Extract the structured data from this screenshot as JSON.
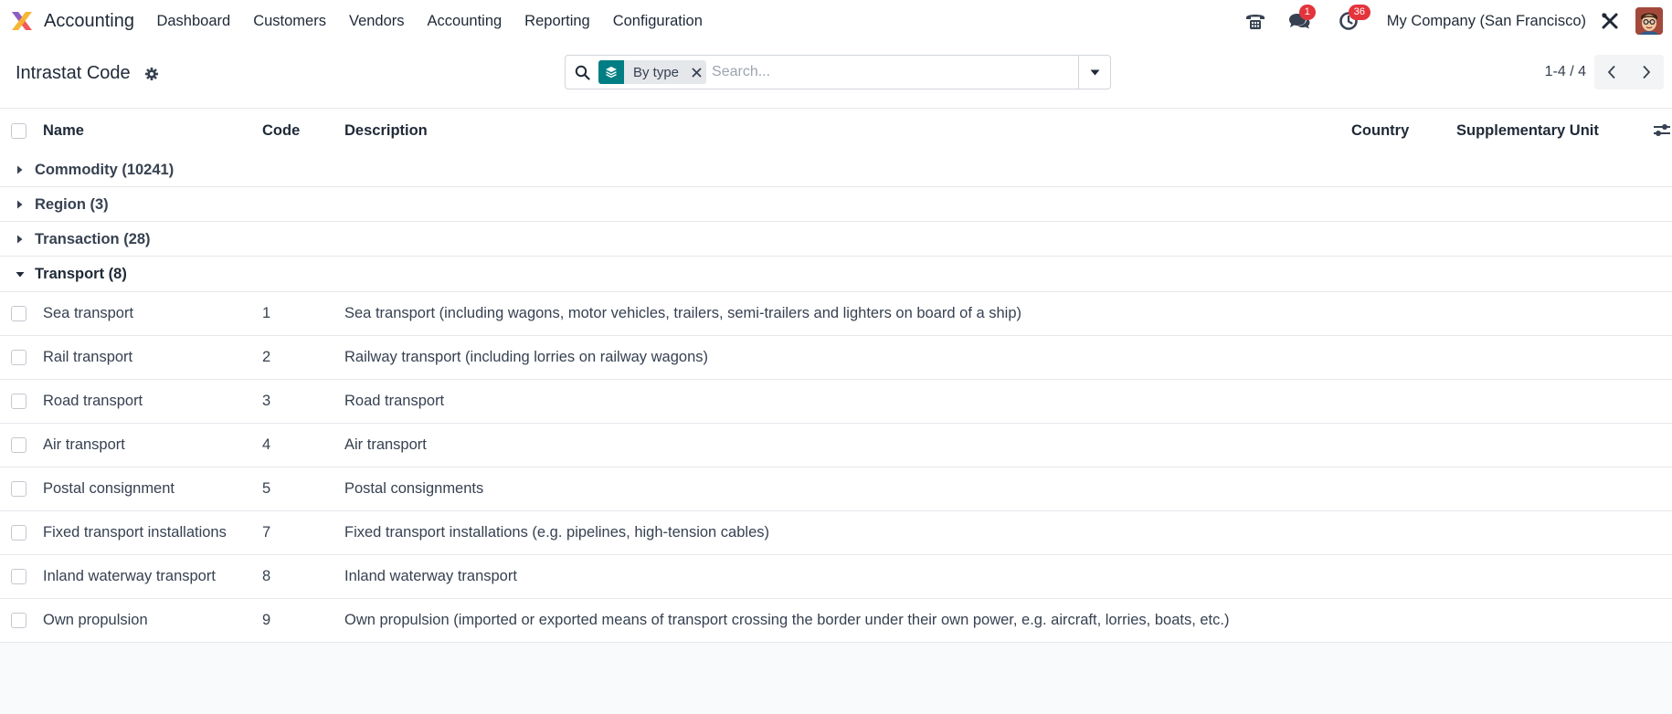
{
  "navbar": {
    "app_name": "Accounting",
    "menu": [
      "Dashboard",
      "Customers",
      "Vendors",
      "Accounting",
      "Reporting",
      "Configuration"
    ],
    "messages_badge": "1",
    "activities_badge": "36",
    "company": "My Company (San Francisco)"
  },
  "control_panel": {
    "title": "Intrastat Code",
    "facet_label": "By type",
    "search_placeholder": "Search...",
    "pager": "1-4 / 4"
  },
  "list": {
    "columns": {
      "name": "Name",
      "code": "Code",
      "description": "Description",
      "country": "Country",
      "unit": "Supplementary Unit"
    },
    "groups": [
      {
        "label": "Commodity (10241)",
        "expanded": false
      },
      {
        "label": "Region (3)",
        "expanded": false
      },
      {
        "label": "Transaction (28)",
        "expanded": false
      },
      {
        "label": "Transport (8)",
        "expanded": true
      }
    ],
    "rows": [
      {
        "name": "Sea transport",
        "code": "1",
        "description": "Sea transport (including wagons, motor vehicles, trailers, semi-trailers and lighters on board of a ship)"
      },
      {
        "name": "Rail transport",
        "code": "2",
        "description": "Railway transport (including lorries on railway wagons)"
      },
      {
        "name": "Road transport",
        "code": "3",
        "description": "Road transport"
      },
      {
        "name": "Air transport",
        "code": "4",
        "description": "Air transport"
      },
      {
        "name": "Postal consignment",
        "code": "5",
        "description": "Postal consignments"
      },
      {
        "name": "Fixed transport installations",
        "code": "7",
        "description": "Fixed transport installations (e.g. pipelines, high-tension cables)"
      },
      {
        "name": "Inland waterway transport",
        "code": "8",
        "description": "Inland waterway transport"
      },
      {
        "name": "Own propulsion",
        "code": "9",
        "description": "Own propulsion (imported or exported means of transport crossing the border under their own power, e.g. aircraft, lorries, boats, etc.)"
      }
    ]
  },
  "colors": {
    "accent": "#017e84",
    "badge": "#e3343c"
  }
}
